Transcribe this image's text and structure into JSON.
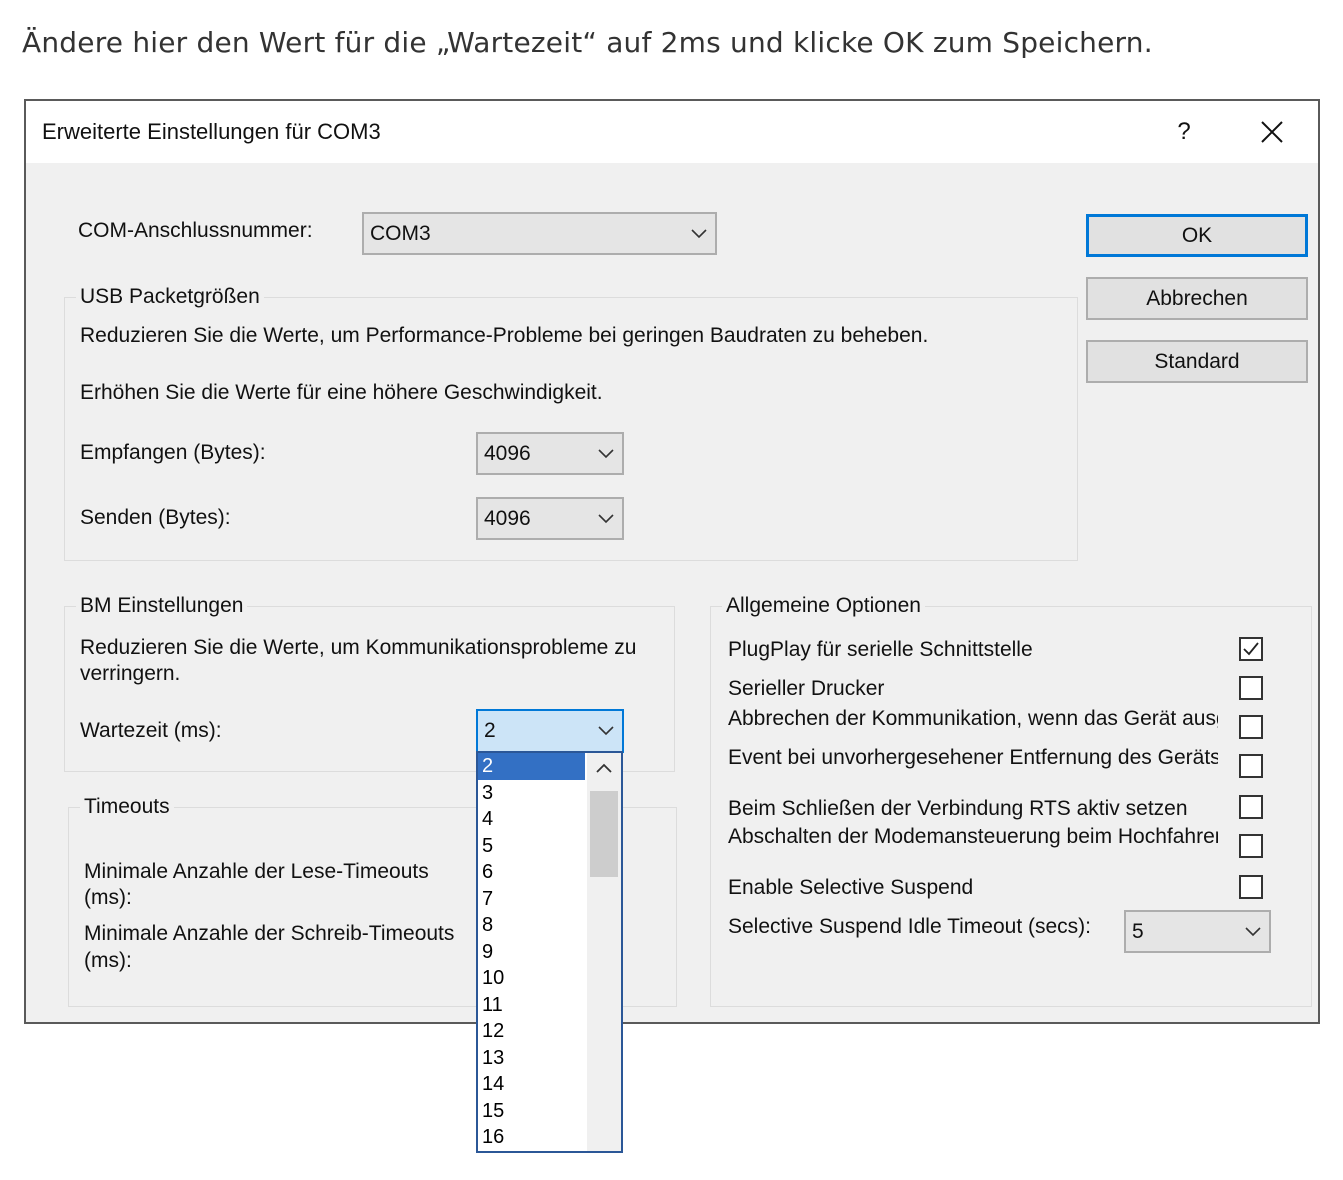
{
  "instruction": "Ändere hier den Wert für die „Wartezeit“ auf 2ms und klicke OK zum Speichern.",
  "dialog": {
    "title": "Erweiterte Einstellungen für COM3",
    "help": "?",
    "close": "✕"
  },
  "com_port": {
    "label": "COM-Anschlussnummer:",
    "value": "COM3"
  },
  "buttons": {
    "ok": "OK",
    "cancel": "Abbrechen",
    "default": "Standard"
  },
  "usb": {
    "title": "USB Packetgrößen",
    "desc1": "Reduzieren Sie die Werte, um Performance-Probleme bei geringen Baudraten zu beheben.",
    "desc2": "Erhöhen Sie die Werte für eine höhere Geschwindigkeit.",
    "receive_label": "Empfangen (Bytes):",
    "receive_value": "4096",
    "send_label": "Senden (Bytes):",
    "send_value": "4096"
  },
  "bm": {
    "title": "BM Einstellungen",
    "desc_line1": "Reduzieren Sie die Werte, um Kommunikationsprobleme zu",
    "desc_line2": "verringern.",
    "latency_label": "Wartezeit (ms):",
    "latency_value": "2",
    "options": [
      "2",
      "3",
      "4",
      "5",
      "6",
      "7",
      "8",
      "9",
      "10",
      "11",
      "12",
      "13",
      "14",
      "15",
      "16"
    ]
  },
  "timeouts": {
    "title": "Timeouts",
    "read_line1": "Minimale Anzahle der Lese-Timeouts",
    "read_line2": "(ms):",
    "write_line1": "Minimale Anzahle der Schreib-Timeouts",
    "write_line2": "(ms):"
  },
  "general": {
    "title": "Allgemeine Optionen",
    "options": [
      {
        "label": "PlugPlay für serielle Schnittstelle",
        "checked": true
      },
      {
        "label": "Serieller Drucker",
        "checked": false
      },
      {
        "label": "Abbrechen der Kommunikation, wenn das Gerät ausgeschaltet wird",
        "checked": false
      },
      {
        "label": "Event bei unvorhergesehener Entfernung des Geräts",
        "checked": false
      },
      {
        "label": "Beim Schließen der Verbindung RTS aktiv setzen",
        "checked": false
      },
      {
        "label": "Abschalten der Modemansteuerung beim Hochfahren des Geräts",
        "checked": false
      },
      {
        "label": "Enable Selective Suspend",
        "checked": false
      }
    ],
    "idle_label": "Selective Suspend Idle Timeout (secs):",
    "idle_value": "5"
  }
}
